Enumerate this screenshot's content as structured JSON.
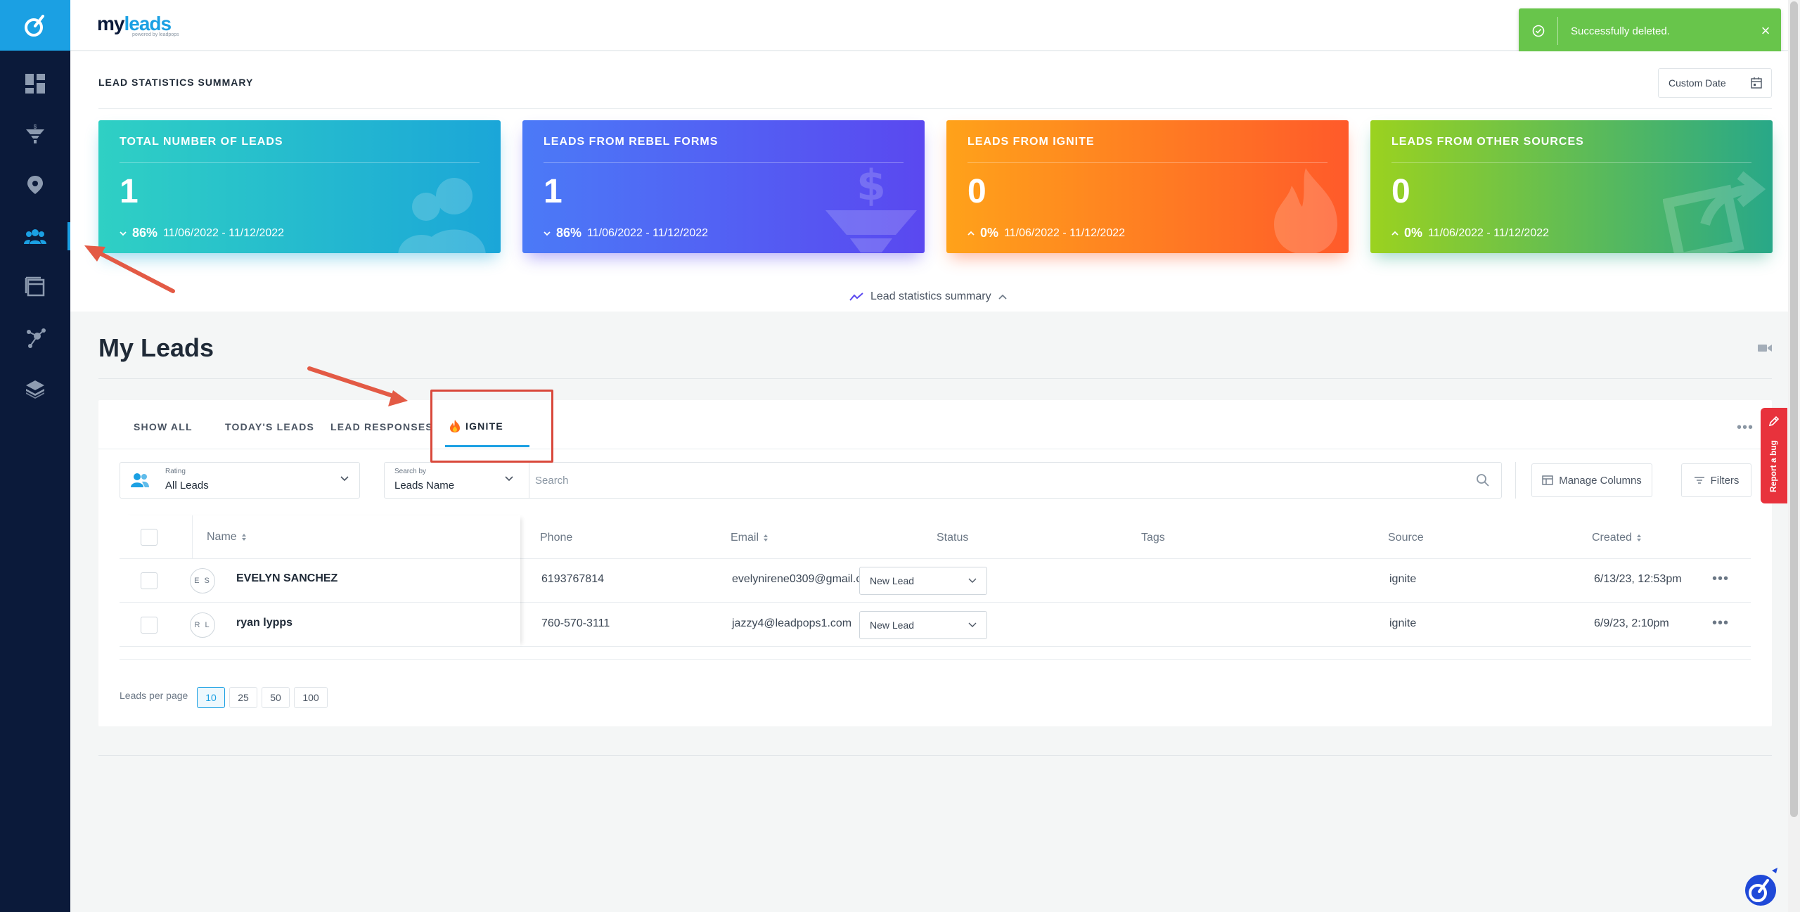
{
  "brand": {
    "name_a": "my",
    "name_b": "leads",
    "subtitle": "powered by leadpops"
  },
  "toast": {
    "message": "Successfully deleted.",
    "close": "×"
  },
  "stats": {
    "title": "LEAD STATISTICS SUMMARY",
    "date_button": "Custom Date",
    "toggle_label": "Lead statistics summary",
    "cards": [
      {
        "title": "TOTAL NUMBER OF LEADS",
        "value": "1",
        "percent": "86%",
        "range": "11/06/2022 - 11/12/2022"
      },
      {
        "title": "LEADS FROM REBEL FORMS",
        "value": "1",
        "percent": "86%",
        "range": "11/06/2022 - 11/12/2022"
      },
      {
        "title": "LEADS FROM IGNITE",
        "value": "0",
        "percent": "0%",
        "range": "11/06/2022 - 11/12/2022"
      },
      {
        "title": "LEADS FROM OTHER SOURCES",
        "value": "0",
        "percent": "0%",
        "range": "11/06/2022 - 11/12/2022"
      }
    ]
  },
  "leads": {
    "title": "My Leads",
    "tabs": [
      {
        "label": "SHOW ALL"
      },
      {
        "label": "TODAY'S LEADS"
      },
      {
        "label": "LEAD RESPONSES"
      },
      {
        "label": "IGNITE"
      }
    ],
    "rating": {
      "label": "Rating",
      "value": "All Leads"
    },
    "search": {
      "label": "Search by",
      "value": "Leads Name",
      "placeholder": "Search"
    },
    "buttons": {
      "manage_columns": "Manage Columns",
      "filters": "Filters"
    },
    "columns": {
      "name": "Name",
      "phone": "Phone",
      "email": "Email",
      "status": "Status",
      "tags": "Tags",
      "source": "Source",
      "created": "Created"
    },
    "rows": [
      {
        "initials": "E S",
        "name": "EVELYN SANCHEZ",
        "phone": "6193767814",
        "email": "evelynirene0309@gmail.com",
        "status": "New Lead",
        "tags": "",
        "source": "ignite",
        "created": "6/13/23, 12:53pm"
      },
      {
        "initials": "R L",
        "name": "ryan lypps",
        "phone": "760-570-3111",
        "email": "jazzy4@leadpops1.com",
        "status": "New Lead",
        "tags": "",
        "source": "ignite",
        "created": "6/9/23, 2:10pm"
      }
    ],
    "per_page": {
      "label": "Leads per page",
      "options": [
        "10",
        "25",
        "50",
        "100"
      ],
      "selected": "10"
    }
  },
  "report_bug": "Report a bug",
  "colors": {
    "accent": "#1ba0e3",
    "sidebar": "#0b1a3a",
    "toast": "#68c54b",
    "annotation": "#d9483b"
  },
  "icons": [
    "dashboard-icon",
    "funnel-icon",
    "location-icon",
    "users-icon",
    "window-icon",
    "share-icon",
    "layers-icon"
  ]
}
